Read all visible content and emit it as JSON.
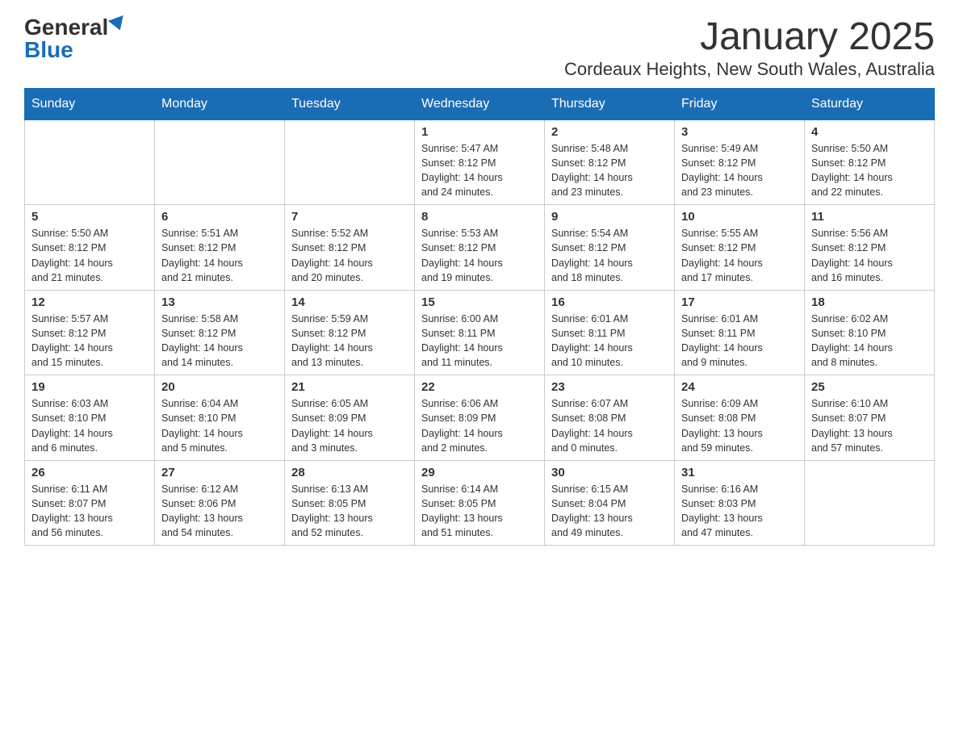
{
  "logo": {
    "general": "General",
    "blue": "Blue"
  },
  "title": "January 2025",
  "location": "Cordeaux Heights, New South Wales, Australia",
  "weekdays": [
    "Sunday",
    "Monday",
    "Tuesday",
    "Wednesday",
    "Thursday",
    "Friday",
    "Saturday"
  ],
  "weeks": [
    [
      {
        "day": "",
        "info": ""
      },
      {
        "day": "",
        "info": ""
      },
      {
        "day": "",
        "info": ""
      },
      {
        "day": "1",
        "info": "Sunrise: 5:47 AM\nSunset: 8:12 PM\nDaylight: 14 hours\nand 24 minutes."
      },
      {
        "day": "2",
        "info": "Sunrise: 5:48 AM\nSunset: 8:12 PM\nDaylight: 14 hours\nand 23 minutes."
      },
      {
        "day": "3",
        "info": "Sunrise: 5:49 AM\nSunset: 8:12 PM\nDaylight: 14 hours\nand 23 minutes."
      },
      {
        "day": "4",
        "info": "Sunrise: 5:50 AM\nSunset: 8:12 PM\nDaylight: 14 hours\nand 22 minutes."
      }
    ],
    [
      {
        "day": "5",
        "info": "Sunrise: 5:50 AM\nSunset: 8:12 PM\nDaylight: 14 hours\nand 21 minutes."
      },
      {
        "day": "6",
        "info": "Sunrise: 5:51 AM\nSunset: 8:12 PM\nDaylight: 14 hours\nand 21 minutes."
      },
      {
        "day": "7",
        "info": "Sunrise: 5:52 AM\nSunset: 8:12 PM\nDaylight: 14 hours\nand 20 minutes."
      },
      {
        "day": "8",
        "info": "Sunrise: 5:53 AM\nSunset: 8:12 PM\nDaylight: 14 hours\nand 19 minutes."
      },
      {
        "day": "9",
        "info": "Sunrise: 5:54 AM\nSunset: 8:12 PM\nDaylight: 14 hours\nand 18 minutes."
      },
      {
        "day": "10",
        "info": "Sunrise: 5:55 AM\nSunset: 8:12 PM\nDaylight: 14 hours\nand 17 minutes."
      },
      {
        "day": "11",
        "info": "Sunrise: 5:56 AM\nSunset: 8:12 PM\nDaylight: 14 hours\nand 16 minutes."
      }
    ],
    [
      {
        "day": "12",
        "info": "Sunrise: 5:57 AM\nSunset: 8:12 PM\nDaylight: 14 hours\nand 15 minutes."
      },
      {
        "day": "13",
        "info": "Sunrise: 5:58 AM\nSunset: 8:12 PM\nDaylight: 14 hours\nand 14 minutes."
      },
      {
        "day": "14",
        "info": "Sunrise: 5:59 AM\nSunset: 8:12 PM\nDaylight: 14 hours\nand 13 minutes."
      },
      {
        "day": "15",
        "info": "Sunrise: 6:00 AM\nSunset: 8:11 PM\nDaylight: 14 hours\nand 11 minutes."
      },
      {
        "day": "16",
        "info": "Sunrise: 6:01 AM\nSunset: 8:11 PM\nDaylight: 14 hours\nand 10 minutes."
      },
      {
        "day": "17",
        "info": "Sunrise: 6:01 AM\nSunset: 8:11 PM\nDaylight: 14 hours\nand 9 minutes."
      },
      {
        "day": "18",
        "info": "Sunrise: 6:02 AM\nSunset: 8:10 PM\nDaylight: 14 hours\nand 8 minutes."
      }
    ],
    [
      {
        "day": "19",
        "info": "Sunrise: 6:03 AM\nSunset: 8:10 PM\nDaylight: 14 hours\nand 6 minutes."
      },
      {
        "day": "20",
        "info": "Sunrise: 6:04 AM\nSunset: 8:10 PM\nDaylight: 14 hours\nand 5 minutes."
      },
      {
        "day": "21",
        "info": "Sunrise: 6:05 AM\nSunset: 8:09 PM\nDaylight: 14 hours\nand 3 minutes."
      },
      {
        "day": "22",
        "info": "Sunrise: 6:06 AM\nSunset: 8:09 PM\nDaylight: 14 hours\nand 2 minutes."
      },
      {
        "day": "23",
        "info": "Sunrise: 6:07 AM\nSunset: 8:08 PM\nDaylight: 14 hours\nand 0 minutes."
      },
      {
        "day": "24",
        "info": "Sunrise: 6:09 AM\nSunset: 8:08 PM\nDaylight: 13 hours\nand 59 minutes."
      },
      {
        "day": "25",
        "info": "Sunrise: 6:10 AM\nSunset: 8:07 PM\nDaylight: 13 hours\nand 57 minutes."
      }
    ],
    [
      {
        "day": "26",
        "info": "Sunrise: 6:11 AM\nSunset: 8:07 PM\nDaylight: 13 hours\nand 56 minutes."
      },
      {
        "day": "27",
        "info": "Sunrise: 6:12 AM\nSunset: 8:06 PM\nDaylight: 13 hours\nand 54 minutes."
      },
      {
        "day": "28",
        "info": "Sunrise: 6:13 AM\nSunset: 8:05 PM\nDaylight: 13 hours\nand 52 minutes."
      },
      {
        "day": "29",
        "info": "Sunrise: 6:14 AM\nSunset: 8:05 PM\nDaylight: 13 hours\nand 51 minutes."
      },
      {
        "day": "30",
        "info": "Sunrise: 6:15 AM\nSunset: 8:04 PM\nDaylight: 13 hours\nand 49 minutes."
      },
      {
        "day": "31",
        "info": "Sunrise: 6:16 AM\nSunset: 8:03 PM\nDaylight: 13 hours\nand 47 minutes."
      },
      {
        "day": "",
        "info": ""
      }
    ]
  ]
}
